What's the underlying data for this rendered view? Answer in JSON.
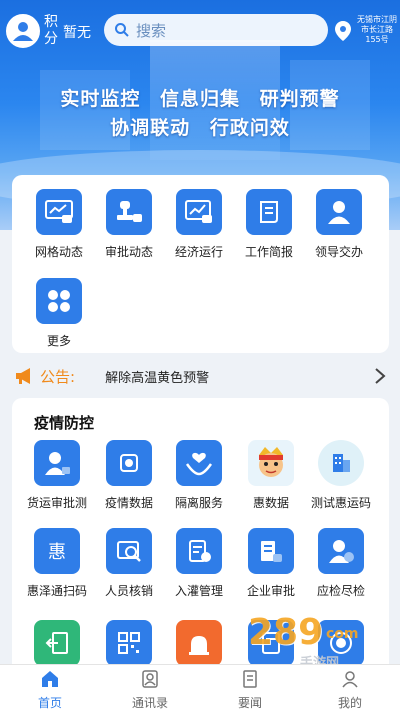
{
  "header": {
    "points_label": "积分",
    "points_value": "暂无",
    "search_placeholder": "搜索",
    "location": "无锡市江阴市长江路155号"
  },
  "banner": {
    "line1": [
      "实时监控",
      "信息归集",
      "研判预警"
    ],
    "line2": [
      "协调联动",
      "行政问效"
    ]
  },
  "quick_menu": [
    {
      "label": "网格动态",
      "icon": "grid-dynamics-icon"
    },
    {
      "label": "审批动态",
      "icon": "approval-dynamics-icon"
    },
    {
      "label": "经济运行",
      "icon": "economy-chart-icon"
    },
    {
      "label": "工作简报",
      "icon": "briefing-scroll-icon"
    },
    {
      "label": "领导交办",
      "icon": "leader-person-icon"
    },
    {
      "label": "更多",
      "icon": "more-grid-icon"
    }
  ],
  "notice": {
    "label": "公告:",
    "text": "解除高温黄色预警"
  },
  "epidemic": {
    "title": "疫情防控",
    "items": [
      {
        "label": "货运审批测",
        "icon": "freight-person-icon"
      },
      {
        "label": "疫情数据",
        "icon": "virus-data-icon"
      },
      {
        "label": "隔离服务",
        "icon": "hands-heart-icon"
      },
      {
        "label": "惠数据",
        "icon": "mascot-icon"
      },
      {
        "label": "测试惠运码",
        "icon": "building-code-icon"
      },
      {
        "label": "惠泽通扫码",
        "icon": "hui-scan-icon"
      },
      {
        "label": "人员核销",
        "icon": "id-search-icon"
      },
      {
        "label": "入灌管理",
        "icon": "form-upload-icon"
      },
      {
        "label": "企业审批",
        "icon": "company-approval-icon"
      },
      {
        "label": "应检尽检",
        "icon": "person-check-icon"
      }
    ],
    "partial_icons": [
      "exit-door-icon",
      "qr-code-icon",
      "alarm-icon",
      "document-icon",
      "target-icon"
    ]
  },
  "nav": [
    {
      "label": "首页",
      "icon": "home-icon",
      "active": true
    },
    {
      "label": "通讯录",
      "icon": "contacts-icon",
      "active": false
    },
    {
      "label": "要闻",
      "icon": "news-icon",
      "active": false
    },
    {
      "label": "我的",
      "icon": "profile-icon",
      "active": false
    }
  ],
  "watermark": {
    "number": "289",
    "suffix": "com",
    "text": "手游网"
  },
  "colors": {
    "primary": "#2f7de8",
    "notice": "#f08a1c"
  }
}
